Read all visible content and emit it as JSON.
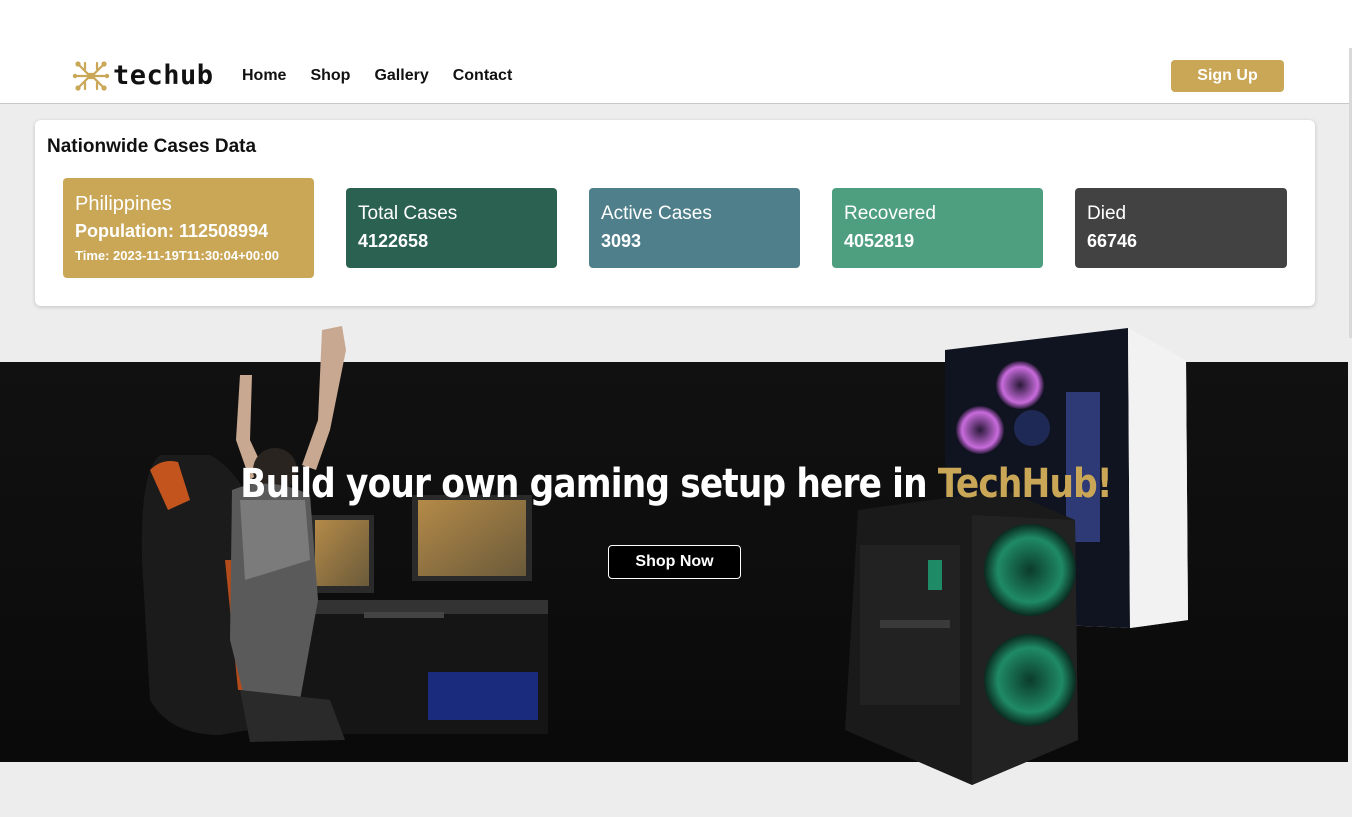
{
  "header": {
    "logo_text": "techub",
    "nav": [
      "Home",
      "Shop",
      "Gallery",
      "Contact"
    ],
    "signup_label": "Sign Up"
  },
  "stats": {
    "title": "Nationwide Cases Data",
    "country": {
      "name": "Philippines",
      "population": "Population: 112508994",
      "time": "Time: 2023-11-19T11:30:04+00:00"
    },
    "cards": [
      {
        "label": "Total Cases",
        "value": "4122658",
        "color": "#2b6151"
      },
      {
        "label": "Active Cases",
        "value": "3093",
        "color": "#4f7f8a"
      },
      {
        "label": "Recovered",
        "value": "4052819",
        "color": "#4e9e80"
      },
      {
        "label": "Died",
        "value": "66746",
        "color": "#424242"
      }
    ]
  },
  "hero": {
    "headline": "Build your own gaming setup here in ",
    "brand": "TechHub!",
    "cta_label": "Shop Now"
  },
  "colors": {
    "accent": "#c9a757",
    "page_background": "#ededed",
    "hero_background": "#0a0a0a"
  }
}
